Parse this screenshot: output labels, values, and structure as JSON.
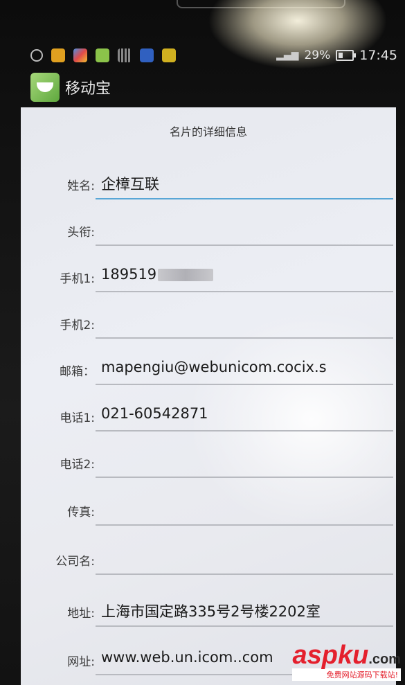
{
  "status_bar": {
    "battery_percent": "29%",
    "clock": "17:45"
  },
  "app": {
    "title": "移动宝"
  },
  "card": {
    "title": "名片的详细信息",
    "fields": [
      {
        "label": "姓名:",
        "value": "企樟互联"
      },
      {
        "label": "头衔:",
        "value": ""
      },
      {
        "label": "手机1:",
        "value": "189519"
      },
      {
        "label": "手机2:",
        "value": ""
      },
      {
        "label": "邮箱：",
        "value": "mapengiu@webunicom.cocix.s"
      },
      {
        "label": "电话1:",
        "value": "021-60542871"
      },
      {
        "label": "电话2:",
        "value": ""
      },
      {
        "label": "传真:",
        "value": ""
      },
      {
        "label": "公司名:",
        "value": ""
      },
      {
        "label": "地址:",
        "value": "上海市国定路335号2号楼2202室"
      },
      {
        "label": "网址:",
        "value": "www.web.un.icom..com"
      }
    ]
  },
  "watermark": {
    "brand": "aspku",
    "suffix": ".com",
    "tagline": "免费网站源码下载站!"
  },
  "colors": {
    "accent_underline": "#58a6d6",
    "watermark_red": "#e4202d"
  }
}
